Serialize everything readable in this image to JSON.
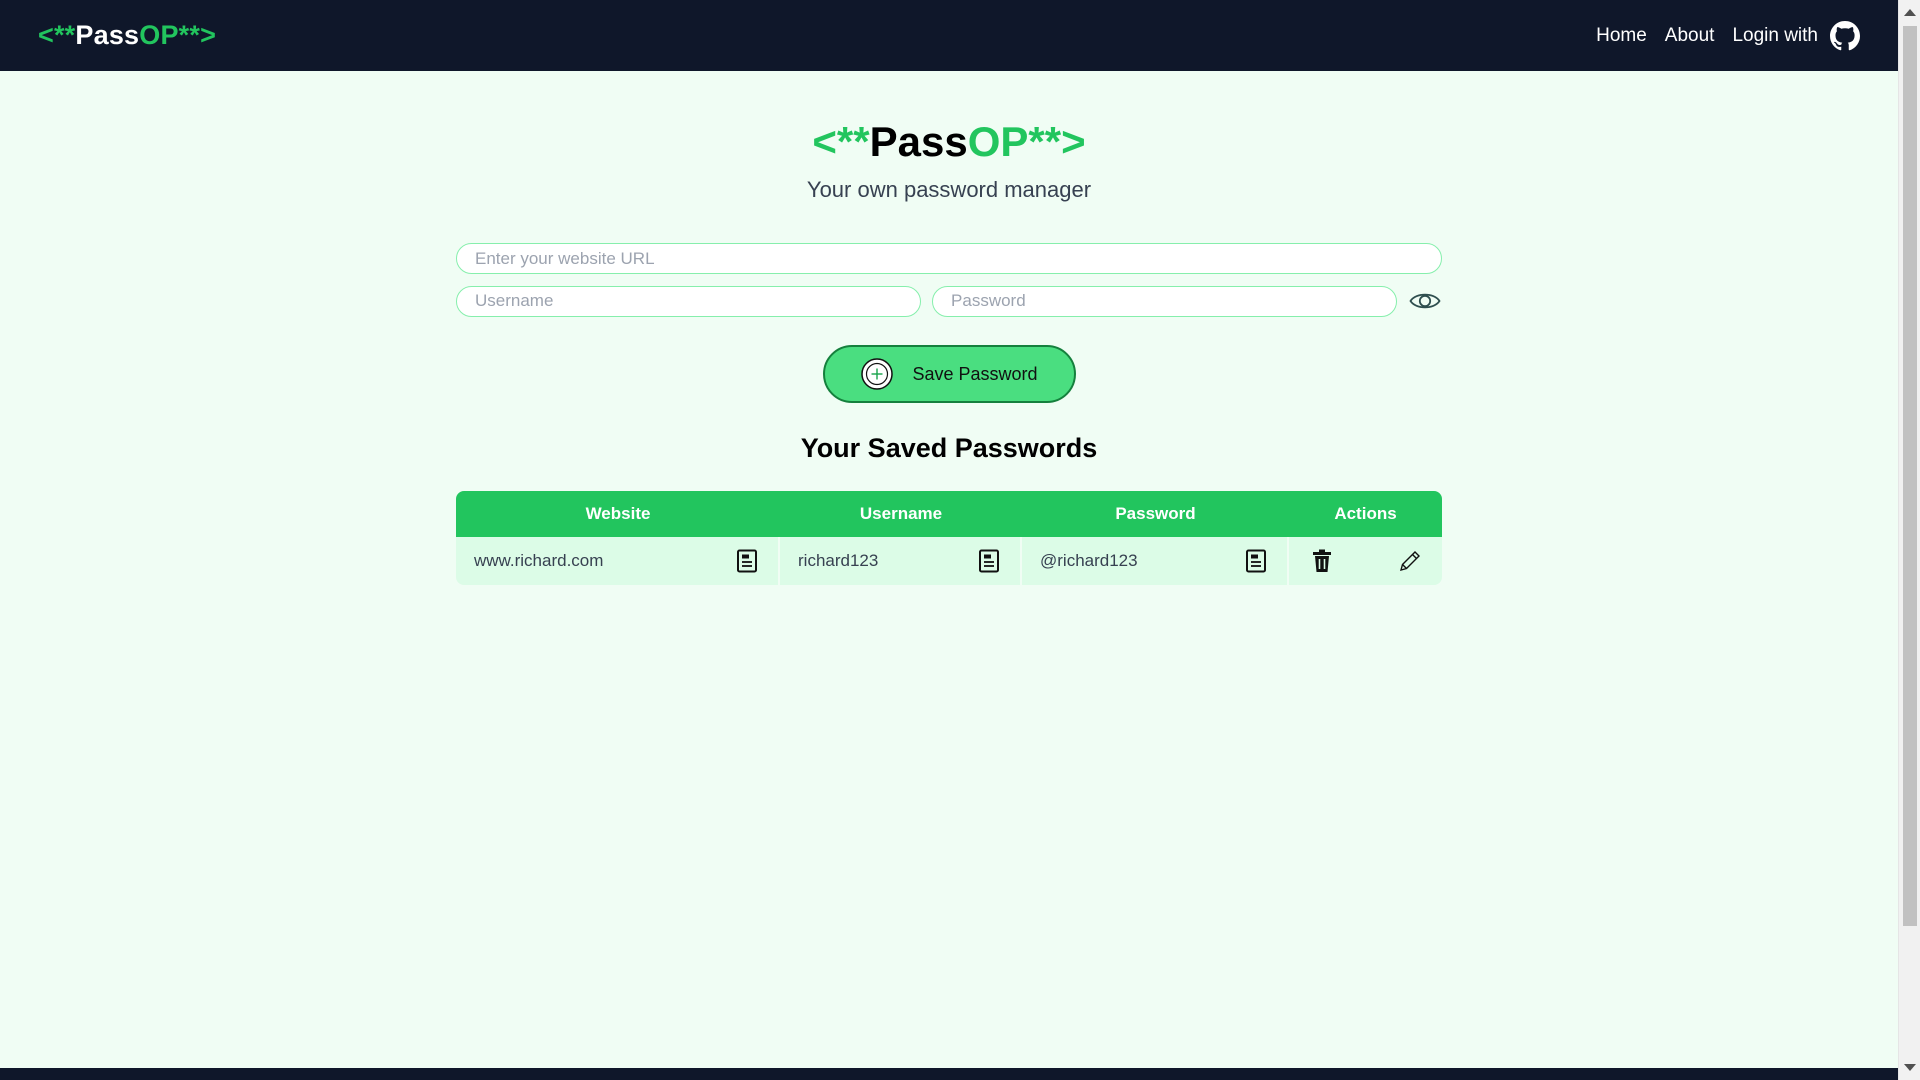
{
  "navbar": {
    "brand": {
      "lt": "<",
      "stars1": "**",
      "pass": "Pass",
      "op": "OP",
      "stars2": "**",
      "gt": ">"
    },
    "links": {
      "home": "Home",
      "about": "About",
      "login": "Login with"
    },
    "login_icon": "github-icon"
  },
  "hero": {
    "title": {
      "lt": "<",
      "stars1": "**",
      "pass": "Pass",
      "op": "OP",
      "stars2": "**",
      "gt": ">"
    },
    "subtitle": "Your own password manager"
  },
  "form": {
    "url_placeholder": "Enter your website URL",
    "username_placeholder": "Username",
    "password_placeholder": "Password",
    "url_value": "",
    "username_value": "",
    "password_value": "",
    "toggle_icon": "eye-icon",
    "save_label": "Save Password",
    "save_icon": "plus-circle-icon"
  },
  "saved": {
    "title": "Your Saved Passwords",
    "columns": [
      "Website",
      "Username",
      "Password",
      "Actions"
    ],
    "rows": [
      {
        "website": "www.richard.com",
        "username": "richard123",
        "password": "@richard123"
      }
    ],
    "copy_icon": "copy-icon",
    "delete_icon": "trash-icon",
    "edit_icon": "pencil-icon"
  },
  "colors": {
    "accent": "#22c55e",
    "navbar_bg": "#0f172a",
    "page_bg": "#f0fdf4",
    "row_bg": "#dcfce7",
    "button_bg": "#4ade80"
  }
}
